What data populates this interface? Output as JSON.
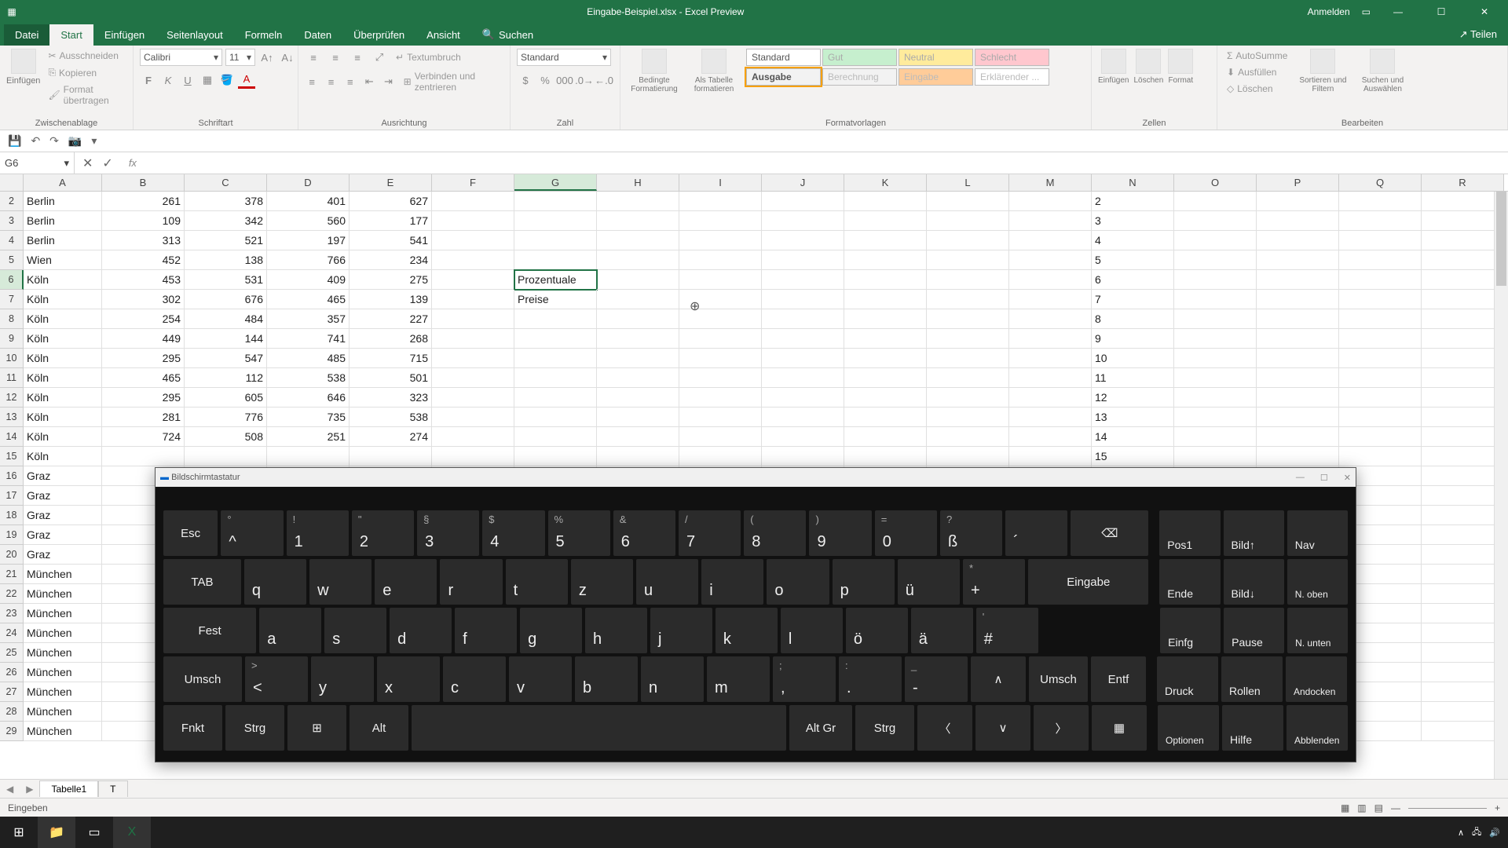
{
  "titlebar": {
    "filename": "Eingabe-Beispiel.xlsx - Excel Preview",
    "signin": "Anmelden"
  },
  "menu": {
    "file": "Datei",
    "start": "Start",
    "insert": "Einfügen",
    "layout": "Seitenlayout",
    "formulas": "Formeln",
    "data": "Daten",
    "review": "Überprüfen",
    "view": "Ansicht",
    "search": "Suchen",
    "share": "Teilen"
  },
  "ribbon": {
    "clipboard": {
      "label": "Zwischenablage",
      "paste": "Einfügen",
      "cut": "Ausschneiden",
      "copy": "Kopieren",
      "format": "Format übertragen"
    },
    "font": {
      "label": "Schriftart",
      "name": "Calibri",
      "size": "11"
    },
    "align": {
      "label": "Ausrichtung",
      "wrap": "Textumbruch",
      "merge": "Verbinden und zentrieren"
    },
    "number": {
      "label": "Zahl",
      "format": "Standard"
    },
    "styles": {
      "label": "Formatvorlagen",
      "cond": "Bedingte Formatierung",
      "table": "Als Tabelle formatieren",
      "std": "Standard",
      "gut": "Gut",
      "neutral": "Neutral",
      "schlecht": "Schlecht",
      "ausgabe": "Ausgabe",
      "berechnung": "Berechnung",
      "eingabe": "Eingabe",
      "erklarend": "Erklärender ..."
    },
    "cells": {
      "label": "Zellen",
      "insert": "Einfügen",
      "delete": "Löschen",
      "format": "Format"
    },
    "edit": {
      "label": "Bearbeiten",
      "sum": "AutoSumme",
      "fill": "Ausfüllen",
      "clear": "Löschen",
      "sort": "Sortieren und Filtern",
      "find": "Suchen und Auswählen"
    }
  },
  "namebox": "G6",
  "columns": [
    "A",
    "B",
    "C",
    "D",
    "E",
    "F",
    "G",
    "H",
    "I",
    "J",
    "K",
    "L",
    "M",
    "N",
    "O",
    "P",
    "Q",
    "R"
  ],
  "selected_col": "G",
  "selected_row": 6,
  "rows": [
    {
      "n": 2,
      "a": "Berlin",
      "b": "261",
      "c": "378",
      "d": "401",
      "e": "627",
      "g": ""
    },
    {
      "n": 3,
      "a": "Berlin",
      "b": "109",
      "c": "342",
      "d": "560",
      "e": "177",
      "g": ""
    },
    {
      "n": 4,
      "a": "Berlin",
      "b": "313",
      "c": "521",
      "d": "197",
      "e": "541",
      "g": ""
    },
    {
      "n": 5,
      "a": "Wien",
      "b": "452",
      "c": "138",
      "d": "766",
      "e": "234",
      "g": ""
    },
    {
      "n": 6,
      "a": "Köln",
      "b": "453",
      "c": "531",
      "d": "409",
      "e": "275",
      "g": "Prozentuale"
    },
    {
      "n": 7,
      "a": "Köln",
      "b": "302",
      "c": "676",
      "d": "465",
      "e": "139",
      "g": "Preise"
    },
    {
      "n": 8,
      "a": "Köln",
      "b": "254",
      "c": "484",
      "d": "357",
      "e": "227",
      "g": ""
    },
    {
      "n": 9,
      "a": "Köln",
      "b": "449",
      "c": "144",
      "d": "741",
      "e": "268",
      "g": ""
    },
    {
      "n": 10,
      "a": "Köln",
      "b": "295",
      "c": "547",
      "d": "485",
      "e": "715",
      "g": ""
    },
    {
      "n": 11,
      "a": "Köln",
      "b": "465",
      "c": "112",
      "d": "538",
      "e": "501",
      "g": ""
    },
    {
      "n": 12,
      "a": "Köln",
      "b": "295",
      "c": "605",
      "d": "646",
      "e": "323",
      "g": ""
    },
    {
      "n": 13,
      "a": "Köln",
      "b": "281",
      "c": "776",
      "d": "735",
      "e": "538",
      "g": ""
    },
    {
      "n": 14,
      "a": "Köln",
      "b": "724",
      "c": "508",
      "d": "251",
      "e": "274",
      "g": ""
    },
    {
      "n": 15,
      "a": "Köln",
      "b": "",
      "c": "",
      "d": "",
      "e": "",
      "g": ""
    },
    {
      "n": 16,
      "a": "Graz",
      "b": "",
      "c": "",
      "d": "",
      "e": "",
      "g": ""
    },
    {
      "n": 17,
      "a": "Graz",
      "b": "",
      "c": "",
      "d": "",
      "e": "",
      "g": ""
    },
    {
      "n": 18,
      "a": "Graz",
      "b": "",
      "c": "",
      "d": "",
      "e": "",
      "g": ""
    },
    {
      "n": 19,
      "a": "Graz",
      "b": "",
      "c": "",
      "d": "",
      "e": "",
      "g": ""
    },
    {
      "n": 20,
      "a": "Graz",
      "b": "",
      "c": "",
      "d": "",
      "e": "",
      "g": ""
    },
    {
      "n": 21,
      "a": "München",
      "b": "",
      "c": "",
      "d": "",
      "e": "",
      "g": ""
    },
    {
      "n": 22,
      "a": "München",
      "b": "",
      "c": "",
      "d": "",
      "e": "",
      "g": ""
    },
    {
      "n": 23,
      "a": "München",
      "b": "",
      "c": "",
      "d": "",
      "e": "",
      "g": ""
    },
    {
      "n": 24,
      "a": "München",
      "b": "",
      "c": "",
      "d": "",
      "e": "",
      "g": ""
    },
    {
      "n": 25,
      "a": "München",
      "b": "",
      "c": "",
      "d": "",
      "e": "",
      "g": ""
    },
    {
      "n": 26,
      "a": "München",
      "b": "",
      "c": "",
      "d": "",
      "e": "",
      "g": ""
    },
    {
      "n": 27,
      "a": "München",
      "b": "",
      "c": "",
      "d": "",
      "e": "",
      "g": ""
    },
    {
      "n": 28,
      "a": "München",
      "b": "",
      "c": "",
      "d": "",
      "e": "",
      "g": ""
    },
    {
      "n": 29,
      "a": "München",
      "b": "",
      "c": "",
      "d": "",
      "e": "",
      "g": ""
    }
  ],
  "sheets": {
    "tab1": "Tabelle1",
    "tab2": "T"
  },
  "status": {
    "mode": "Eingeben",
    "zoom": "+"
  },
  "osk": {
    "title": "Bildschirmtastatur",
    "r1": {
      "esc": "Esc",
      "k1s": "!",
      "k1": "1",
      "k2s": "\"",
      "k2": "2",
      "k3s": "§",
      "k3": "3",
      "k4s": "$",
      "k4": "4",
      "k5s": "%",
      "k5": "5",
      "k6s": "&",
      "k6": "6",
      "k7s": "/",
      "k7": "7",
      "k8s": "(",
      "k8": "8",
      "k9s": ")",
      "k9": "9",
      "k0s": "=",
      "k0": "0",
      "kss": "?",
      "kss2": "ß",
      "kac": "´",
      "bksp": "⌫",
      "caret": "^",
      "carets": "°"
    },
    "r2": {
      "tab": "TAB",
      "q": "q",
      "w": "w",
      "e": "e",
      "r": "r",
      "t": "t",
      "z": "z",
      "u": "u",
      "i": "i",
      "o": "o",
      "p": "p",
      "ue": "ü",
      "plus": "+",
      "pluss": "*",
      "enter": "Eingabe"
    },
    "r3": {
      "caps": "Fest",
      "a": "a",
      "s": "s",
      "d": "d",
      "f": "f",
      "g": "g",
      "h": "h",
      "j": "j",
      "k": "k",
      "l": "l",
      "oe": "ö",
      "ae": "ä",
      "hash": "#",
      "hashs": "'"
    },
    "r4": {
      "shift": "Umsch",
      "lt": "<",
      "lts": ">",
      "y": "y",
      "x": "x",
      "c": "c",
      "v": "v",
      "b": "b",
      "n": "n",
      "m": "m",
      "comma": ",",
      "commas": ";",
      "dot": ".",
      "dots": ":",
      "dash": "-",
      "dashs": "_",
      "up": "∧",
      "shift2": "Umsch",
      "del": "Entf"
    },
    "r5": {
      "fn": "Fnkt",
      "ctrl": "Strg",
      "win": "⊞",
      "alt": "Alt",
      "altgr": "Alt Gr",
      "ctrl2": "Strg",
      "left": "〈",
      "down": "∨",
      "right": "〉",
      "menu": "▦"
    },
    "nav": {
      "pos1": "Pos1",
      "bildauf": "Bild↑",
      "nav": "Nav",
      "ende": "Ende",
      "bildab": "Bild↓",
      "noben": "N. oben",
      "einfg": "Einfg",
      "pause": "Pause",
      "nunten": "N. unten",
      "druck": "Druck",
      "rollen": "Rollen",
      "andocken": "Andocken",
      "optionen": "Optionen",
      "hilfe": "Hilfe",
      "ablenden": "Abblenden"
    }
  }
}
